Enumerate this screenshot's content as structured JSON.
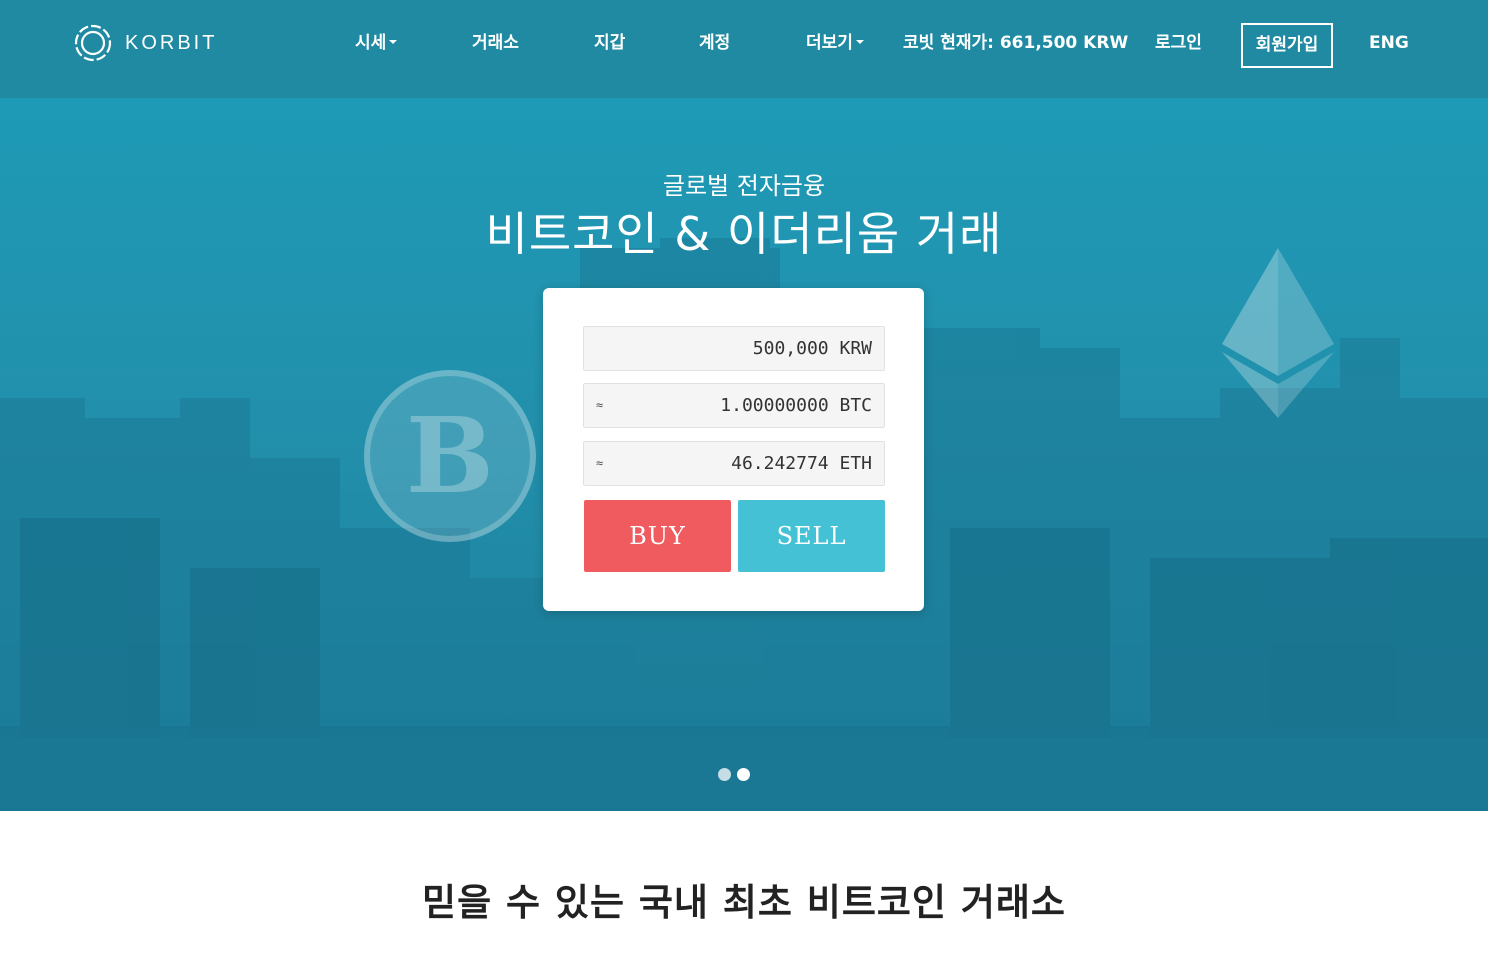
{
  "header": {
    "logo_text": "KORBIT",
    "nav": [
      {
        "label": "시세",
        "has_dropdown": true
      },
      {
        "label": "거래소",
        "has_dropdown": false
      },
      {
        "label": "지갑",
        "has_dropdown": false
      },
      {
        "label": "계정",
        "has_dropdown": false
      },
      {
        "label": "더보기",
        "has_dropdown": true
      }
    ],
    "price_label": "코빗 현재가: 661,500 KRW",
    "login_label": "로그인",
    "signup_label": "회원가입",
    "language_label": "ENG"
  },
  "hero": {
    "subtitle": "글로벌 전자금융",
    "title": "비트코인 & 이더리움 거래",
    "coin_letter": "B",
    "calculator": {
      "krw_value": "500,000 KRW",
      "btc_prefix": "≈",
      "btc_value": "1.00000000 BTC",
      "eth_prefix": "≈",
      "eth_value": "46.242774 ETH",
      "buy_label": "BUY",
      "sell_label": "SELL"
    },
    "slides_total": 2,
    "slides_active": 2
  },
  "section": {
    "title": "믿을 수 있는 국내 최초 비트코인 거래소"
  },
  "colors": {
    "header_bg": "#1f8aa2",
    "hero_bg": "#2290ac",
    "buy": "#ef5b5e",
    "sell": "#45c1d6",
    "text_dark": "#222222"
  },
  "icons": {
    "logo": "korbit-ring-icon",
    "coin": "bitcoin-coin-icon",
    "eth": "ethereum-diamond-icon",
    "caret": "caret-down-icon"
  }
}
